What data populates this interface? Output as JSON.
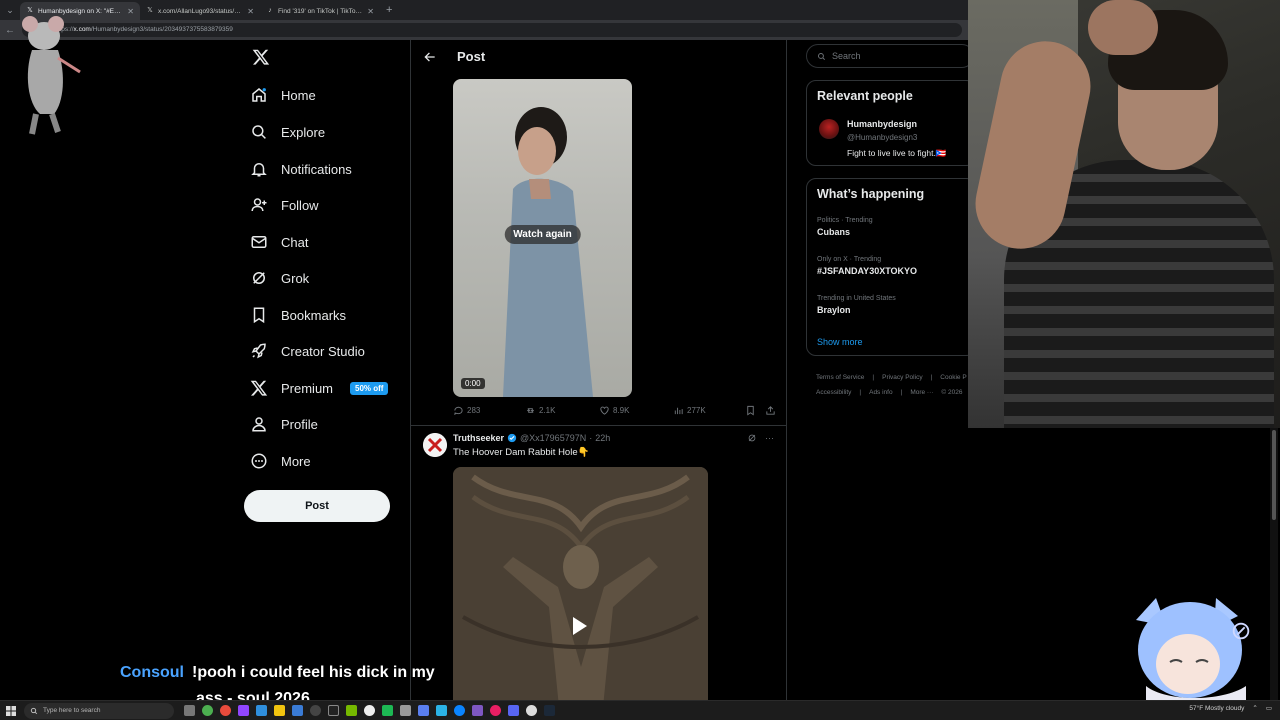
{
  "browser": {
    "tabs": [
      {
        "icon": "x-favicon-icon",
        "title": "Humanbydesign on X: \"#EMF blo...",
        "active": true
      },
      {
        "icon": "x-favicon-icon",
        "title": "x.com/AllanLugo93/status/203525...",
        "active": false
      },
      {
        "icon": "tiktok-icon",
        "title": "Find '319' on TikTok | TikTok Searc...",
        "active": false
      }
    ],
    "url_prefix": "https://",
    "url_host": "x.com",
    "url_path": "/Humanbydesign3/status/2034937375583879359"
  },
  "nav": {
    "items": [
      {
        "label": "Home",
        "icon": "home-icon"
      },
      {
        "label": "Explore",
        "icon": "search-icon"
      },
      {
        "label": "Notifications",
        "icon": "bell-icon"
      },
      {
        "label": "Follow",
        "icon": "person-add-icon"
      },
      {
        "label": "Chat",
        "icon": "mail-icon"
      },
      {
        "label": "Grok",
        "icon": "grok-icon"
      },
      {
        "label": "Bookmarks",
        "icon": "bookmark-icon"
      },
      {
        "label": "Creator Studio",
        "icon": "rocket-icon"
      },
      {
        "label": "Premium",
        "icon": "x-logo-icon"
      },
      {
        "label": "Profile",
        "icon": "person-icon"
      },
      {
        "label": "More",
        "icon": "more-circle-icon"
      }
    ],
    "premium_badge": "50% off",
    "post_button": "Post"
  },
  "main": {
    "header_title": "Post",
    "video": {
      "watch_again": "Watch again",
      "time": "0:00"
    },
    "actions": {
      "replies": "283",
      "reposts": "2.1K",
      "likes": "8.9K",
      "views": "277K"
    },
    "next_post": {
      "name": "Truthseeker",
      "handle": "@Xx17965797N",
      "time": "22h",
      "text": "The Hoover Dam Rabbit Hole👇"
    }
  },
  "right": {
    "search_placeholder": "Search",
    "relevant_people": {
      "title": "Relevant people",
      "name": "Humanbydesign",
      "handle": "@Humanbydesign3",
      "bio": "Fight to live live to fight.🇵🇷"
    },
    "whats_happening": {
      "title": "What’s happening",
      "trends": [
        {
          "context": "Politics · Trending",
          "name": "Cubans"
        },
        {
          "context": "Only on X · Trending",
          "name": "#JSFANDAY30XTOKYO"
        },
        {
          "context": "Trending in United States",
          "name": "Braylon"
        }
      ],
      "show_more": "Show more"
    },
    "footer": {
      "line1": [
        "Terms of Service",
        "|",
        "Privacy Policy",
        "|",
        "Cookie P"
      ],
      "line2": [
        "Accessibility",
        "|",
        "Ads info",
        "|",
        "More ···",
        "© 2026"
      ]
    }
  },
  "overlay": {
    "chat_user": "Consoul",
    "chat_line1": "!pooh i could feel his dick in my",
    "chat_line2": "ass - soul 2026"
  },
  "taskbar": {
    "search_placeholder": "Type here to search",
    "weather": "57°F  Mostly cloudy"
  },
  "colors": {
    "accent": "#1d9bf0",
    "background": "#000000",
    "border": "#2f3336",
    "text_primary": "#e7e9ea",
    "text_secondary": "#71767b"
  }
}
